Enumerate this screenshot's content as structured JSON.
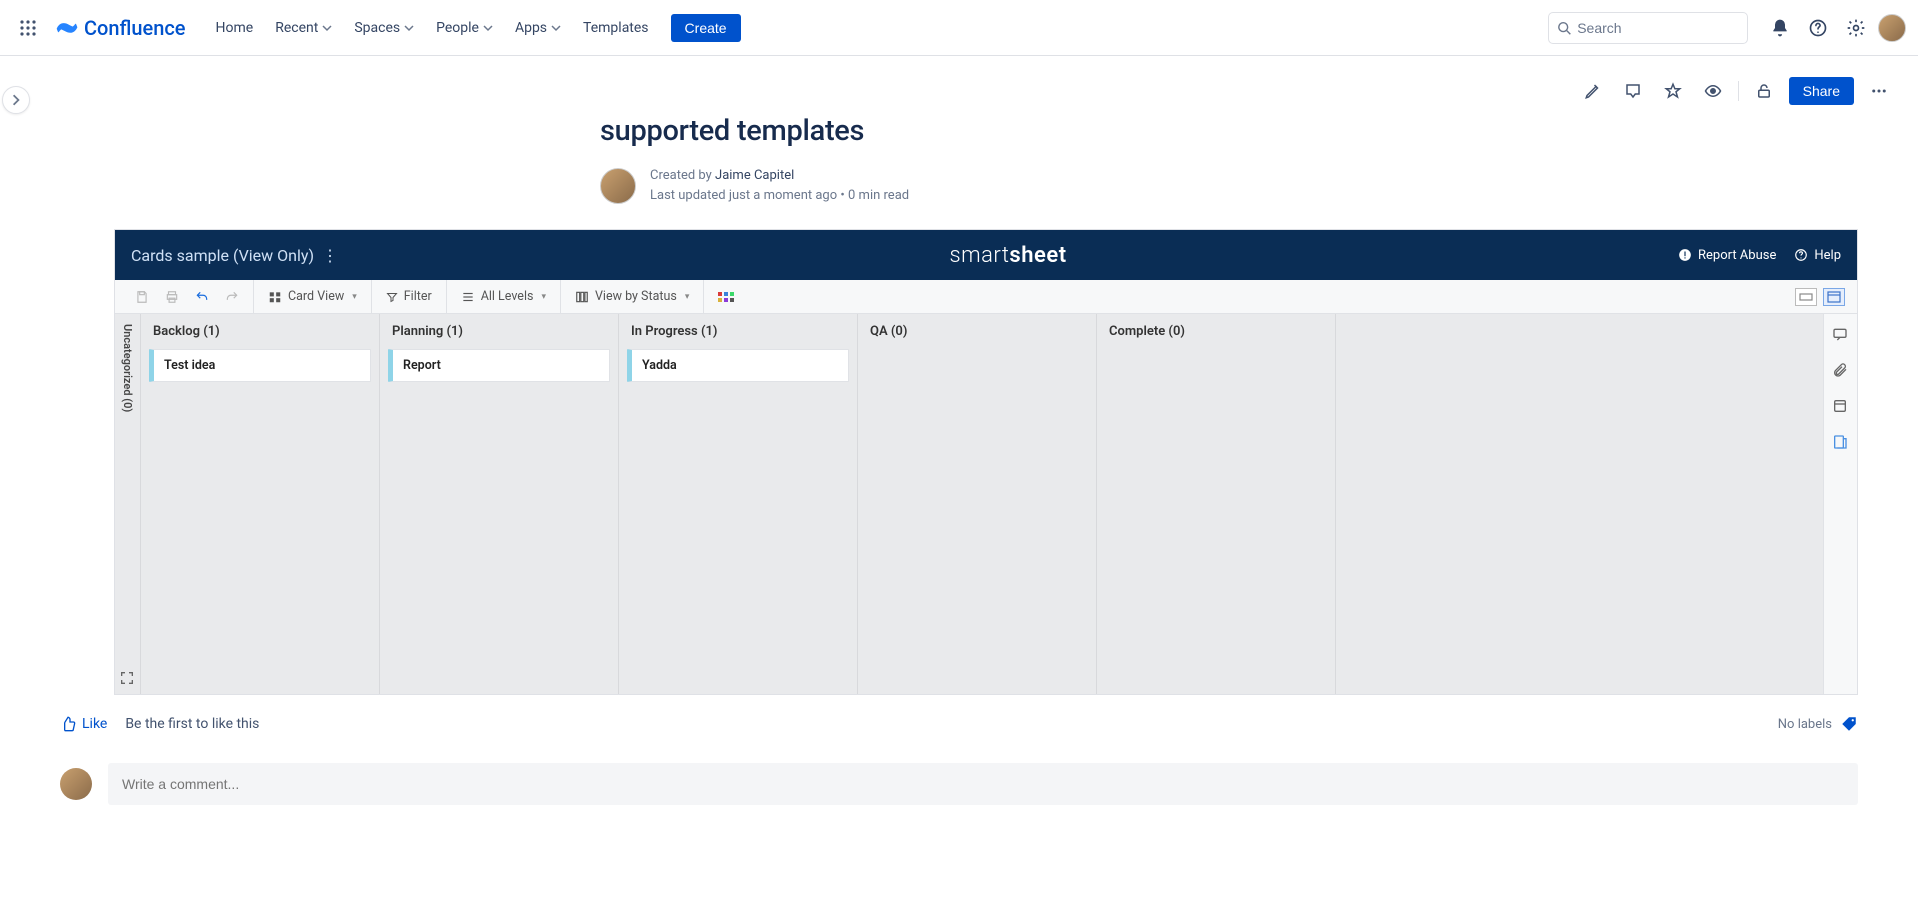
{
  "nav": {
    "product": "Confluence",
    "items": [
      "Home",
      "Recent",
      "Spaces",
      "People",
      "Apps",
      "Templates"
    ],
    "items_caret": [
      false,
      true,
      true,
      true,
      true,
      false
    ],
    "create": "Create",
    "search_placeholder": "Search"
  },
  "page": {
    "title": "supported templates",
    "created_by_prefix": "Created by ",
    "author": "Jaime Capitel",
    "updated": "Last updated just a moment ago",
    "read_time": "0 min read",
    "share": "Share"
  },
  "smartsheet": {
    "title": "Cards sample (View Only)",
    "brand_a": "smart",
    "brand_b": "sheet",
    "report_abuse": "Report Abuse",
    "help": "Help",
    "toolbar": {
      "card_view": "Card View",
      "filter": "Filter",
      "all_levels": "All Levels",
      "view_by_status": "View by Status"
    },
    "rail": "Uncategorized (0)",
    "lanes": [
      {
        "title": "Backlog (1)",
        "cards": [
          "Test idea"
        ]
      },
      {
        "title": "Planning (1)",
        "cards": [
          "Report"
        ]
      },
      {
        "title": "In Progress (1)",
        "cards": [
          "Yadda"
        ]
      },
      {
        "title": "QA (0)",
        "cards": []
      },
      {
        "title": "Complete (0)",
        "cards": []
      }
    ]
  },
  "footer": {
    "like": "Like",
    "first_like": "Be the first to like this",
    "no_labels": "No labels",
    "comment_placeholder": "Write a comment..."
  }
}
